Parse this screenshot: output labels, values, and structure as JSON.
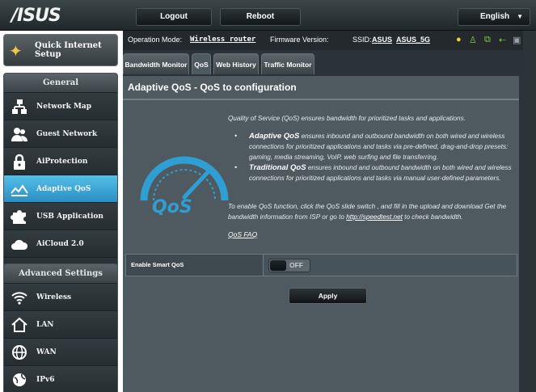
{
  "header": {
    "logo": "/ISUS",
    "logout": "Logout",
    "reboot": "Reboot",
    "language": "English",
    "caret": "▼"
  },
  "sidebar": {
    "quick_setup": "Quick Internet Setup",
    "general_title": "General",
    "general_items": [
      {
        "label": "Network Map",
        "icon": "network-map-icon"
      },
      {
        "label": "Guest Network",
        "icon": "guest-network-icon"
      },
      {
        "label": "AiProtection",
        "icon": "lock-icon"
      },
      {
        "label": "Adaptive QoS",
        "icon": "adaptive-qos-icon",
        "active": true
      },
      {
        "label": "USB Application",
        "icon": "puzzle-icon"
      },
      {
        "label": "AiCloud 2.0",
        "icon": "cloud-icon"
      }
    ],
    "advanced_title": "Advanced Settings",
    "advanced_items": [
      {
        "label": "Wireless",
        "icon": "wireless-icon"
      },
      {
        "label": "LAN",
        "icon": "house-icon"
      },
      {
        "label": "WAN",
        "icon": "globe-icon"
      },
      {
        "label": "IPv6",
        "icon": "ipv6-globe-icon"
      }
    ]
  },
  "status": {
    "mode_label": "Operation Mode:",
    "mode_value": "Wireless router",
    "firmware_label": "Firmware Version:",
    "ssid_label": "SSID:",
    "ssid_1": "ASUS",
    "ssid_2": "ASUS_5G"
  },
  "tabs": [
    "Bandwidth Monitor",
    "QoS",
    "Web History",
    "Traffic Monitor"
  ],
  "active_tab": "QoS",
  "panel": {
    "title": "Adaptive QoS - QoS to configuration",
    "intro": "Quality of Service (QoS) ensures bandwidth for prioritized tasks and applications.",
    "bullet1_title": "Adaptive QoS",
    "bullet1_text": " ensures inbound and outbound bandwidth on both wired and wireless connections for prioritized applications and tasks via pre-defined, drag-and-drop presets: gaming, media streaming, VoIP, web surfing and file transferring.",
    "bullet2_title": "Traditional QoS",
    "bullet2_text": " ensures inbound and outbound bandwidth on both wired and wireless connections for prioritized applications and tasks via manual user-defined parameters.",
    "enable_text_before": "To enable QoS function, click the QoS slide switch , and fill in the upload and download Get the bandwidth information from ISP or go to ",
    "enable_link": "http://speedtest.net",
    "enable_text_after": " to check bandwidth.",
    "faq": "QoS FAQ",
    "logo_text": "QoS",
    "enable_label": "Enable Smart QoS",
    "switch_state": "OFF",
    "apply": "Apply"
  },
  "colors": {
    "accent_active": "#3aa8da",
    "panel_bg": "#4e5a60",
    "logo_blue": "#2f9fd3"
  }
}
